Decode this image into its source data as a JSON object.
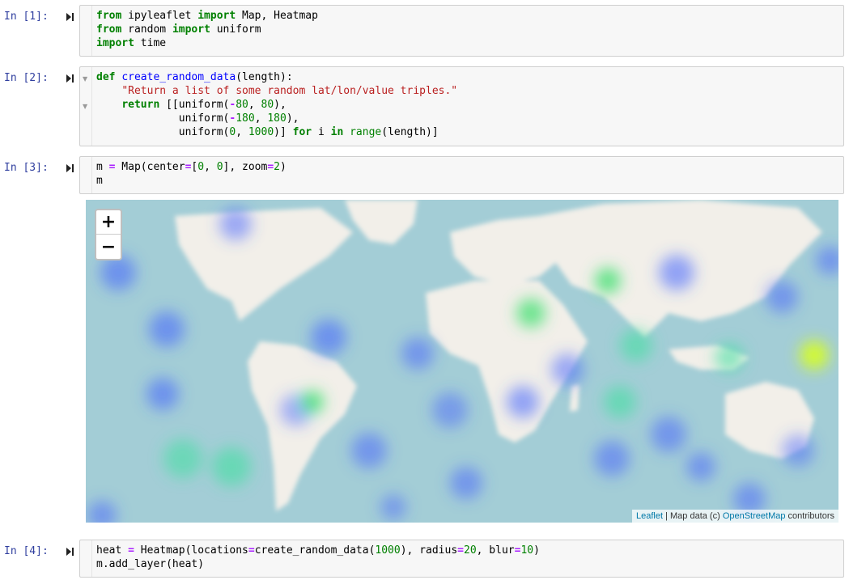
{
  "cells": [
    {
      "prompt": "In [1]:",
      "lines": [
        [
          [
            "from",
            "kw"
          ],
          [
            " ipyleaflet ",
            ""
          ],
          [
            "import",
            "kw"
          ],
          [
            " Map, Heatmap",
            ""
          ]
        ],
        [
          [
            "from",
            "kw"
          ],
          [
            " random ",
            ""
          ],
          [
            "import",
            "kw"
          ],
          [
            " uniform",
            ""
          ]
        ],
        [
          [
            "import",
            "kw"
          ],
          [
            " time",
            ""
          ]
        ]
      ]
    },
    {
      "prompt": "In [2]:",
      "lines": [
        [
          [
            "def",
            "kw"
          ],
          [
            " ",
            ""
          ],
          [
            "create_random_data",
            "fn"
          ],
          [
            "(length):",
            ""
          ]
        ],
        [
          [
            "    ",
            ""
          ],
          [
            "\"Return a list of some random lat/lon/value triples.\"",
            "str"
          ]
        ],
        [
          [
            "    ",
            ""
          ],
          [
            "return",
            "kw"
          ],
          [
            " [[uniform(",
            ""
          ],
          [
            "-",
            "op"
          ],
          [
            "80",
            "num"
          ],
          [
            ", ",
            ""
          ],
          [
            "80",
            "num"
          ],
          [
            "),",
            ""
          ]
        ],
        [
          [
            "             uniform(",
            ""
          ],
          [
            "-",
            "op"
          ],
          [
            "180",
            "num"
          ],
          [
            ", ",
            ""
          ],
          [
            "180",
            "num"
          ],
          [
            "),",
            ""
          ]
        ],
        [
          [
            "             uniform(",
            ""
          ],
          [
            "0",
            "num"
          ],
          [
            ", ",
            ""
          ],
          [
            "1000",
            "num"
          ],
          [
            ")] ",
            ""
          ],
          [
            "for",
            "kw"
          ],
          [
            " i ",
            ""
          ],
          [
            "in",
            "kw"
          ],
          [
            " ",
            ""
          ],
          [
            "range",
            "bi"
          ],
          [
            "(length)]",
            ""
          ]
        ]
      ]
    },
    {
      "prompt": "In [3]:",
      "lines": [
        [
          [
            "m ",
            ""
          ],
          [
            "=",
            "op"
          ],
          [
            " Map(center",
            ""
          ],
          [
            "=",
            "op"
          ],
          [
            "[",
            ""
          ],
          [
            "0",
            "num"
          ],
          [
            ", ",
            ""
          ],
          [
            "0",
            "num"
          ],
          [
            "], zoom",
            ""
          ],
          [
            "=",
            "op"
          ],
          [
            "2",
            "num"
          ],
          [
            ")",
            ""
          ]
        ],
        [
          [
            "m",
            ""
          ]
        ]
      ]
    },
    {
      "prompt": "In [4]:",
      "lines": [
        [
          [
            "heat ",
            ""
          ],
          [
            "=",
            "op"
          ],
          [
            " Heatmap(locations",
            ""
          ],
          [
            "=",
            "op"
          ],
          [
            "create_random_data(",
            ""
          ],
          [
            "1000",
            "num"
          ],
          [
            "), radius",
            ""
          ],
          [
            "=",
            "op"
          ],
          [
            "20",
            "num"
          ],
          [
            ", blur",
            ""
          ],
          [
            "=",
            "op"
          ],
          [
            "10",
            "num"
          ],
          [
            ")",
            ""
          ]
        ],
        [
          [
            "m.add_layer(heat)",
            ""
          ]
        ]
      ]
    }
  ],
  "map": {
    "zoom_in_label": "+",
    "zoom_out_label": "−",
    "attribution": {
      "leaflet_link": "Leaflet",
      "separator": " | Map data (c) ",
      "osm_link": "OpenStreetMap",
      "suffix": " contributors"
    }
  },
  "icons": {
    "run": "run-cell-icon",
    "fold": "fold-arrow-icon"
  },
  "colors": {
    "ocean": "#a3cdd6",
    "land": "#f2efe9",
    "heat_blue": "#4060ff",
    "heat_green": "#40e070",
    "heat_yellow": "#d8ff20",
    "prompt": "#303f9f"
  }
}
